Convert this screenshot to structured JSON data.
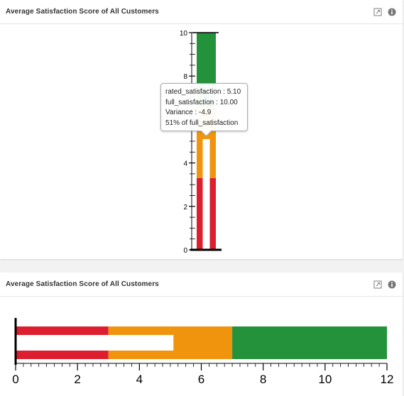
{
  "colors": {
    "poor": "#dc1e2e",
    "average": "#f0940e",
    "good": "#23923a",
    "measure": "#ffffff",
    "axis": "#000000"
  },
  "icons": [
    "expand-icon",
    "info-icon"
  ],
  "panels": [
    {
      "title": "Average Satisfaction Score of All Customers",
      "orientation": "vertical"
    },
    {
      "title": "Average Satisfaction Score of All Customers",
      "orientation": "horizontal"
    }
  ],
  "tooltip": {
    "lines": [
      "rated_satisfaction : 5.10",
      "full_satisfaction : 10.00",
      "Variance : -4.9",
      "51% of full_satisfaction"
    ]
  },
  "chart_data": [
    {
      "type": "bar",
      "subtype": "bullet",
      "orientation": "vertical",
      "title": "Average Satisfaction Score of All Customers",
      "ranges": [
        {
          "from": 0,
          "to": 3.3,
          "color": "#dc1e2e"
        },
        {
          "from": 3.3,
          "to": 6.6,
          "color": "#f0940e"
        },
        {
          "from": 6.6,
          "to": 10,
          "color": "#23923a"
        }
      ],
      "measure": 5.1,
      "target": 10,
      "axis": {
        "min": 0,
        "max": 10,
        "ticks": [
          "0",
          "2",
          "4",
          "6",
          "8",
          "10"
        ]
      }
    },
    {
      "type": "bar",
      "subtype": "bullet",
      "orientation": "horizontal",
      "title": "Average Satisfaction Score of All Customers",
      "ranges": [
        {
          "from": 0,
          "to": 3,
          "color": "#dc1e2e"
        },
        {
          "from": 3,
          "to": 7,
          "color": "#f0940e"
        },
        {
          "from": 7,
          "to": 12,
          "color": "#23923a"
        }
      ],
      "measure": 5.1,
      "axis": {
        "min": 0,
        "max": 12,
        "ticks": [
          "0",
          "2",
          "4",
          "6",
          "8",
          "10",
          "12"
        ]
      }
    }
  ]
}
